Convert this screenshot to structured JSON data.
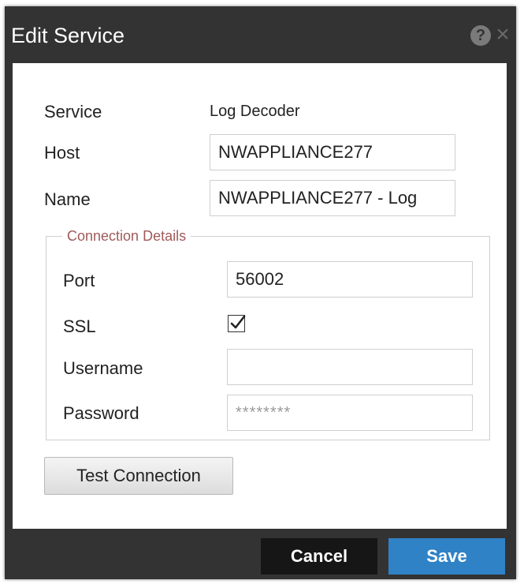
{
  "dialog": {
    "title": "Edit Service",
    "help_icon": "question-circle-icon",
    "close_icon": "close-icon",
    "help_glyph": "?",
    "close_glyph": "×"
  },
  "form": {
    "service": {
      "label": "Service",
      "value": "Log Decoder"
    },
    "host": {
      "label": "Host",
      "value": "NWAPPLIANCE277"
    },
    "name": {
      "label": "Name",
      "value": "NWAPPLIANCE277 - Log"
    }
  },
  "connection": {
    "legend": "Connection Details",
    "port": {
      "label": "Port",
      "value": "56002"
    },
    "ssl": {
      "label": "SSL",
      "checked": true
    },
    "username": {
      "label": "Username",
      "value": ""
    },
    "password": {
      "label": "Password",
      "value": "********"
    }
  },
  "buttons": {
    "test_connection": "Test Connection",
    "cancel": "Cancel",
    "save": "Save"
  },
  "colors": {
    "chrome": "#333333",
    "save_accent": "#2f82c6",
    "legend_text": "#a05a5a"
  }
}
